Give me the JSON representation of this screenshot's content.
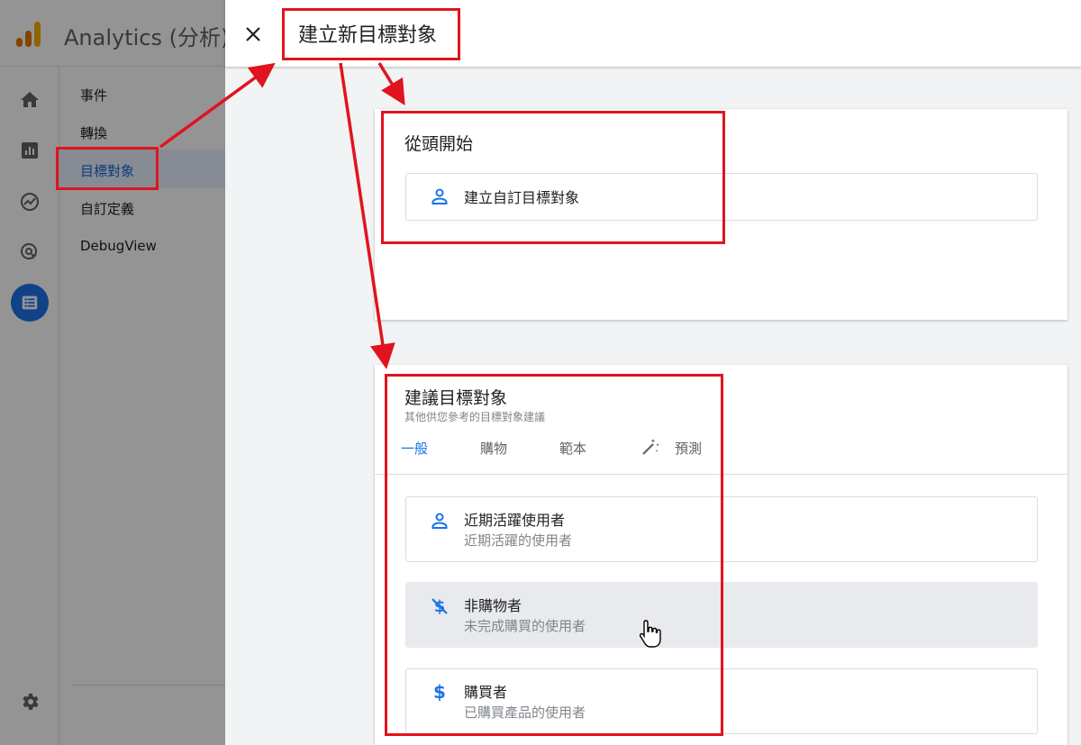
{
  "app": {
    "title": "Analytics (分析)"
  },
  "subnav": {
    "items": [
      {
        "label": "事件"
      },
      {
        "label": "轉換"
      },
      {
        "label": "目標對象"
      },
      {
        "label": "自訂定義"
      },
      {
        "label": "DebugView"
      }
    ]
  },
  "rail": {
    "icons": [
      "home-icon",
      "reports-icon",
      "explore-icon",
      "advertising-icon",
      "configure-icon",
      "settings-icon"
    ]
  },
  "panel": {
    "title": "建立新目標對象",
    "close_icon": "close-icon"
  },
  "scratch": {
    "title": "從頭開始",
    "item": {
      "label": "建立自訂目標對象",
      "icon": "person-icon"
    }
  },
  "suggested": {
    "title": "建議目標對象",
    "subtitle": "其他供您參考的目標對象建議",
    "tabs": [
      {
        "label": "一般",
        "active": true
      },
      {
        "label": "購物"
      },
      {
        "label": "範本"
      },
      {
        "label": "預測",
        "icon": "magic-wand-icon"
      }
    ],
    "items": [
      {
        "title": "近期活躍使用者",
        "desc": "近期活躍的使用者",
        "icon": "person-icon"
      },
      {
        "title": "非購物者",
        "desc": "未完成購買的使用者",
        "icon": "no-dollar-icon"
      },
      {
        "title": "購買者",
        "desc": "已購買產品的使用者",
        "icon": "dollar-icon"
      }
    ]
  },
  "colors": {
    "accent": "#1a73e8",
    "annotation": "#e0141e",
    "panel_bg": "#f1f3f4"
  }
}
